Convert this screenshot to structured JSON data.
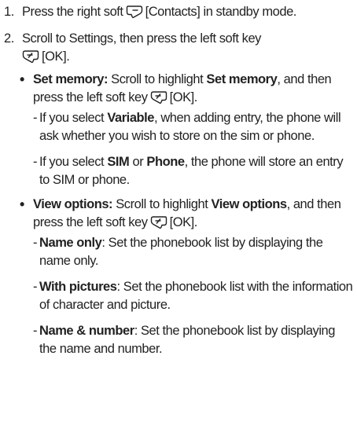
{
  "steps": [
    {
      "num": "1.",
      "pre": "Press the right soft",
      "key_icon": "right-soft-key-icon",
      "post": "[Contacts] in standby mode."
    },
    {
      "num": "2.",
      "pre": "Scroll to Settings, then press the left soft key",
      "key_icon": "left-soft-key-icon",
      "post": "[OK]."
    }
  ],
  "set_memory": {
    "title": "Set memory:",
    "t1": "Scroll to highlight",
    "bold": "Set memory",
    "t2": ", and then press the left soft key",
    "key_icon": "left-soft-key-icon",
    "t3": "[OK].",
    "sub1": {
      "t1": "If you select",
      "b1": "Variable",
      "t2": ", when adding entry, the phone will ask whether you wish to store on the sim or phone."
    },
    "sub2": {
      "t1": "If you select",
      "b1": "SIM",
      "t2": "or",
      "b2": "Phone",
      "t3": ", the phone will store an entry to SIM or phone."
    }
  },
  "view_options": {
    "title": "View options:",
    "t1": "Scroll to highlight",
    "bold": "View options",
    "t2": ", and then press the left soft key",
    "key_icon": "left-soft-key-icon",
    "t3": "[OK].",
    "subs": [
      {
        "bold": "Name only",
        "text": ": Set the phonebook list by displaying the name only."
      },
      {
        "bold": "With pictures",
        "text": ": Set the phonebook list with the information of character and picture."
      },
      {
        "bold": "Name & number",
        "text": ": Set the phonebook list by displaying the name and number."
      }
    ]
  }
}
